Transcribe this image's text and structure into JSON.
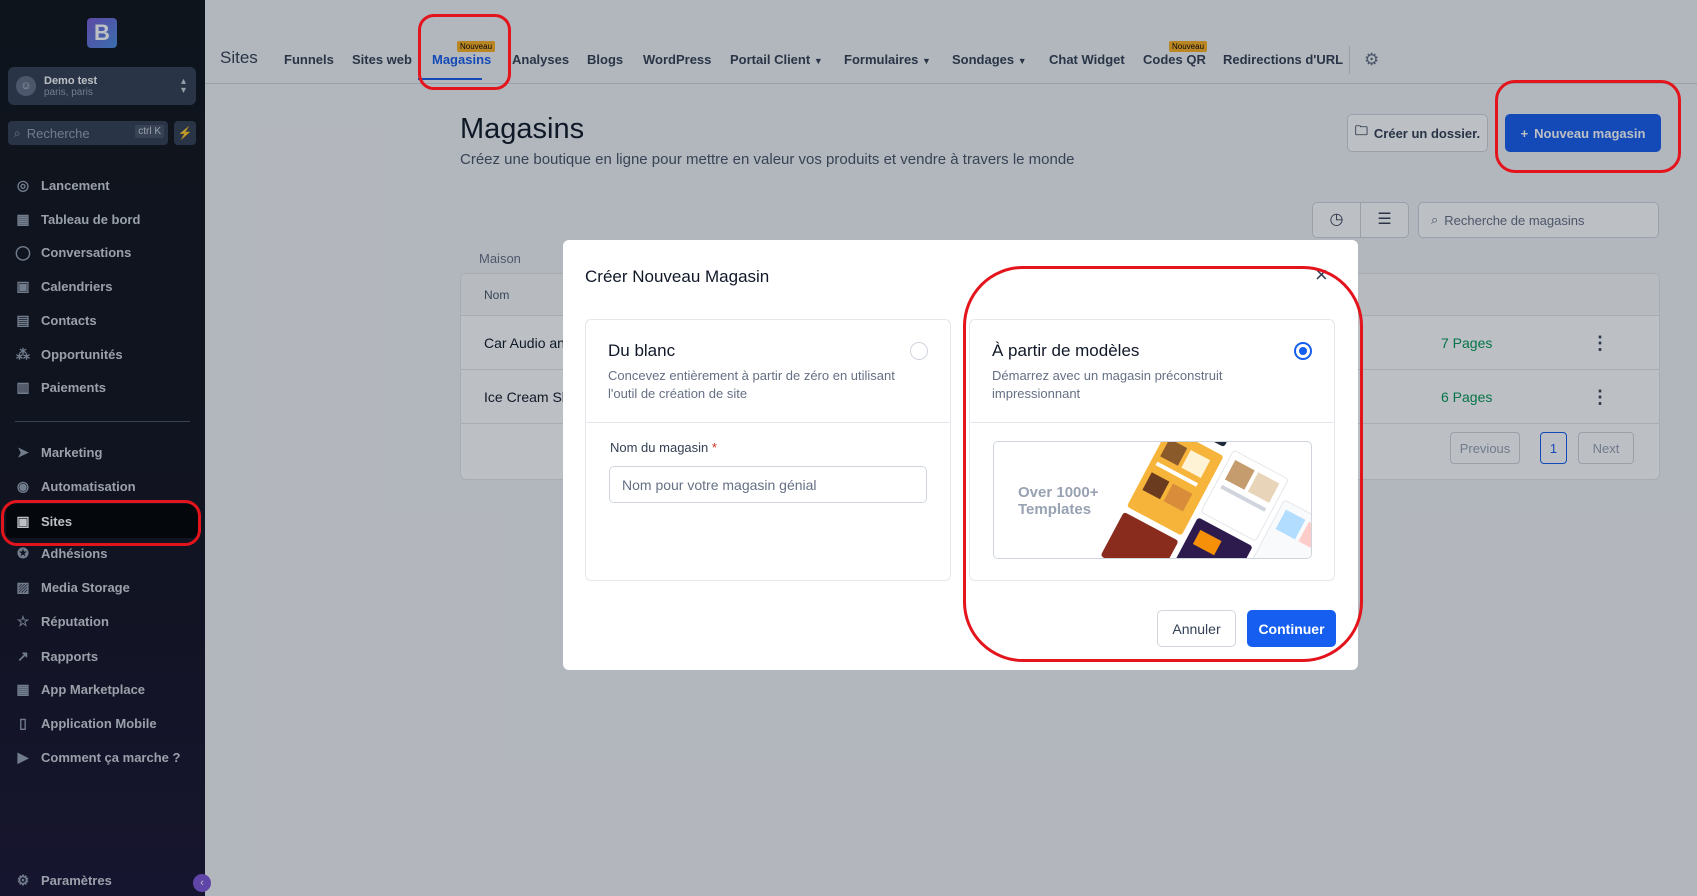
{
  "sidebar": {
    "logo": "B",
    "account": {
      "name": "Demo test",
      "location": "paris, paris"
    },
    "search": {
      "placeholder": "Recherche",
      "shortcut": "ctrl K"
    },
    "items": [
      {
        "label": "Lancement",
        "icon": "rocket-icon"
      },
      {
        "label": "Tableau de bord",
        "icon": "dashboard-icon"
      },
      {
        "label": "Conversations",
        "icon": "chat-icon"
      },
      {
        "label": "Calendriers",
        "icon": "calendar-icon"
      },
      {
        "label": "Contacts",
        "icon": "contacts-icon"
      },
      {
        "label": "Opportunités",
        "icon": "opportunities-icon"
      },
      {
        "label": "Paiements",
        "icon": "payments-icon"
      },
      {
        "label": "Marketing",
        "icon": "send-icon"
      },
      {
        "label": "Automatisation",
        "icon": "automation-icon"
      },
      {
        "label": "Sites",
        "icon": "sites-icon"
      },
      {
        "label": "Adhésions",
        "icon": "badge-icon"
      },
      {
        "label": "Media Storage",
        "icon": "image-icon"
      },
      {
        "label": "Réputation",
        "icon": "star-icon"
      },
      {
        "label": "Rapports",
        "icon": "trend-icon"
      },
      {
        "label": "App Marketplace",
        "icon": "grid-icon"
      },
      {
        "label": "Application Mobile",
        "icon": "mobile-icon"
      },
      {
        "label": "Comment ça marche ?",
        "icon": "video-icon"
      }
    ],
    "settings": "Paramètres"
  },
  "topbar": {
    "title": "Sites",
    "tabs": [
      {
        "label": "Funnels"
      },
      {
        "label": "Sites web"
      },
      {
        "label": "Magasins",
        "badge": "Nouveau",
        "active": true
      },
      {
        "label": "Analyses"
      },
      {
        "label": "Blogs"
      },
      {
        "label": "WordPress"
      },
      {
        "label": "Portail Client",
        "dropdown": true
      },
      {
        "label": "Formulaires",
        "dropdown": true
      },
      {
        "label": "Sondages",
        "dropdown": true
      },
      {
        "label": "Chat Widget"
      },
      {
        "label": "Codes QR",
        "badge": "Nouveau"
      },
      {
        "label": "Redirections d'URL"
      }
    ]
  },
  "page": {
    "title": "Magasins",
    "subtitle": "Créez une boutique en ligne pour mettre en valeur vos produits et vendre à travers le monde",
    "folder_button": "Créer un dossier.",
    "new_button": "Nouveau magasin",
    "search_placeholder": "Recherche de magasins",
    "breadcrumb": "Maison",
    "table": {
      "header": "Nom",
      "rows": [
        {
          "name": "Car Audio an",
          "pages": "7 Pages"
        },
        {
          "name": "Ice Cream Sh",
          "pages": "6 Pages"
        }
      ],
      "pagination": {
        "previous": "Previous",
        "current": "1",
        "next": "Next"
      }
    }
  },
  "modal": {
    "title": "Créer Nouveau Magasin",
    "blank": {
      "title": "Du blanc",
      "description": "Concevez entièrement à partir de zéro en utilisant l'outil de création de site",
      "field_label": "Nom du magasin",
      "required_mark": "*",
      "placeholder": "Nom pour votre magasin génial"
    },
    "template": {
      "title": "À partir de modèles",
      "description": "Démarrez avec un magasin préconstruit impressionnant",
      "promo": "Over 1000+ Templates",
      "selected": true
    },
    "cancel": "Annuler",
    "continue": "Continuer"
  },
  "colors": {
    "accent": "#155eef",
    "annotation": "#e3141c",
    "success": "#039855"
  }
}
